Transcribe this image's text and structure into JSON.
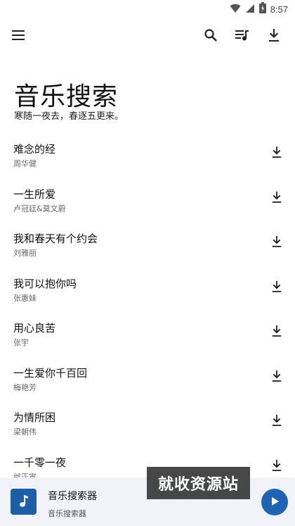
{
  "status_bar": {
    "time": "8:57",
    "icons": [
      "wifi-icon",
      "signal-icon",
      "battery-charging-icon"
    ]
  },
  "toolbar": {
    "icons": [
      "menu-icon",
      "search-icon",
      "playlist-icon",
      "download-icon"
    ]
  },
  "header": {
    "title": "音乐搜索",
    "subtitle": "寒随一夜去，春逐五更来。"
  },
  "songs": [
    {
      "title": "难念的经",
      "artist": "周华健"
    },
    {
      "title": "一生所爱",
      "artist": "卢冠廷&莫文蔚"
    },
    {
      "title": "我和春天有个约会",
      "artist": "刘雅丽"
    },
    {
      "title": "我可以抱你吗",
      "artist": "张惠妹"
    },
    {
      "title": "用心良苦",
      "artist": "张宇"
    },
    {
      "title": "一生爱你千百回",
      "artist": "梅艳芳"
    },
    {
      "title": "为情所困",
      "artist": "梁朝伟"
    },
    {
      "title": "一千零一夜",
      "artist": "邰正宵"
    }
  ],
  "player": {
    "title": "音乐搜索器",
    "subtitle": "音乐搜索器"
  },
  "watermark": {
    "text": "就收资源站"
  },
  "colors": {
    "accent": "#1f63b4",
    "player_bg": "#f1f3f9",
    "art_bg": "#1a5fa8"
  }
}
